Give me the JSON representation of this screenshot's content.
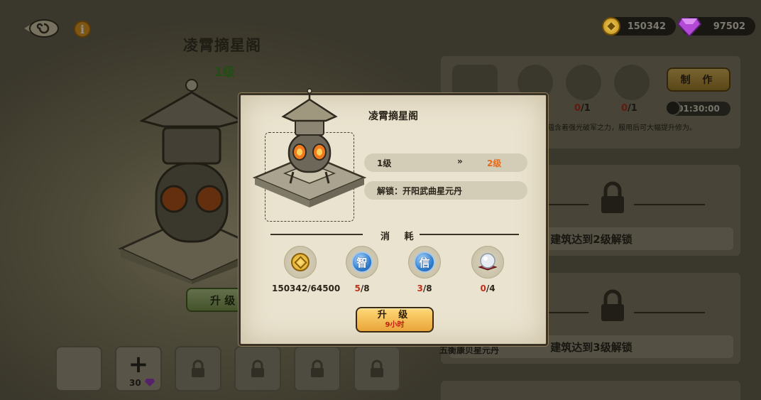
{
  "header": {
    "building_title": "凌霄摘星阁",
    "building_level": "1级",
    "info_icon": "i"
  },
  "currency": {
    "coins": "150342",
    "gems": "97502"
  },
  "background": {
    "upgrade_button": "升 级",
    "slots": [
      {
        "type": "empty"
      },
      {
        "type": "add",
        "cost": "30"
      },
      {
        "type": "locked"
      },
      {
        "type": "locked"
      },
      {
        "type": "locked"
      },
      {
        "type": "locked"
      }
    ]
  },
  "right_panel": {
    "craft_button": "制 作",
    "timer": "01:30:00",
    "material_counts": [
      {
        "have": "0",
        "need": "/1"
      },
      {
        "have": "0",
        "need": "/1"
      }
    ],
    "description": "蕴含着强光破军之力，服用后可大幅提升修为。",
    "unlock_level2": "建筑达到2级解锁",
    "unlock_level3": "建筑达到3级解锁",
    "side_text": "五衡康贝星元丹"
  },
  "modal": {
    "title": "凌霄摘星阁",
    "level_from": "1级",
    "level_arrow": "»",
    "level_to": "2级",
    "unlock_text": "解锁：开阳武曲星元丹",
    "cost_title": "消 耗",
    "costs": [
      {
        "icon": "coin-icon",
        "have": "150342",
        "need": "/64500",
        "insufficient": false
      },
      {
        "icon": "wisdom-orb-icon",
        "glyph": "智",
        "have": "5",
        "need": "/8",
        "insufficient": true
      },
      {
        "icon": "trust-orb-icon",
        "glyph": "信",
        "have": "3",
        "need": "/8",
        "insufficient": true
      },
      {
        "icon": "crystal-orb-icon",
        "have": "0",
        "need": "/4",
        "insufficient": true
      }
    ],
    "upgrade_label": "升 级",
    "upgrade_time": "9小时"
  },
  "colors": {
    "accent_orange": "#e46b1a",
    "insufficient_red": "#c0301c",
    "button_gold": "#e9a53a",
    "panel_bg": "#eae3cf"
  }
}
